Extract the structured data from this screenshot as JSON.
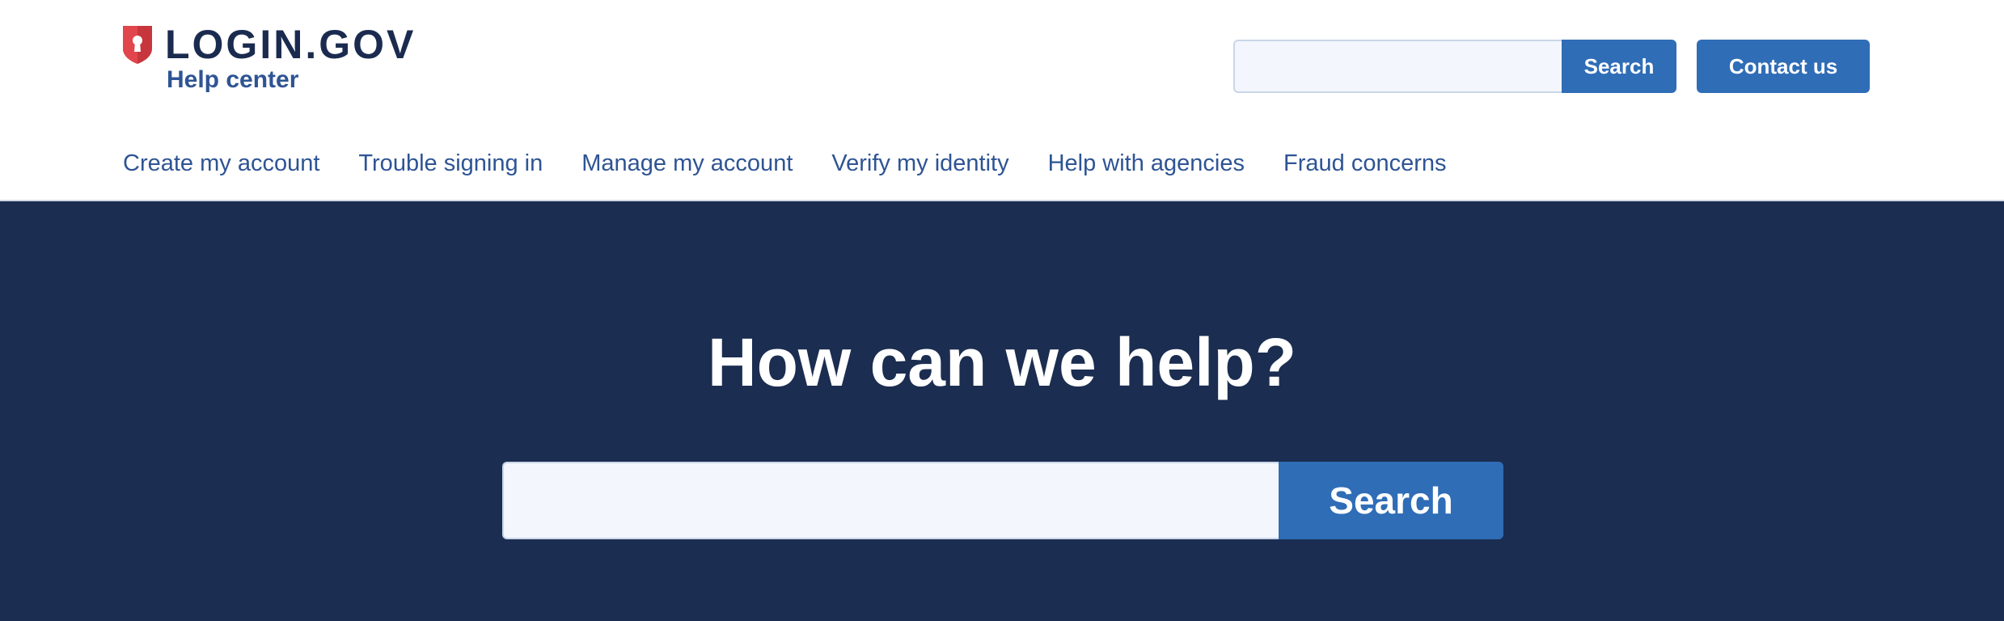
{
  "header": {
    "brand": "LOGIN.GOV",
    "subbrand": "Help center",
    "search": {
      "placeholder": "",
      "value": "",
      "button_label": "Search"
    },
    "contact_label": "Contact us",
    "nav": [
      {
        "label": "Create my account"
      },
      {
        "label": "Trouble signing in"
      },
      {
        "label": "Manage my account"
      },
      {
        "label": "Verify my identity"
      },
      {
        "label": "Help with agencies"
      },
      {
        "label": "Fraud concerns"
      }
    ]
  },
  "hero": {
    "title": "How can we help?",
    "search": {
      "placeholder": "",
      "value": "",
      "button_label": "Search"
    }
  },
  "colors": {
    "brand_navy": "#1b2b4f",
    "hero_bg": "#1b2d50",
    "accent_blue": "#2f6db7",
    "link_blue": "#2e5494",
    "shield_red": "#c8363d"
  },
  "icons": {
    "logo": "keyhole-shield-icon"
  }
}
